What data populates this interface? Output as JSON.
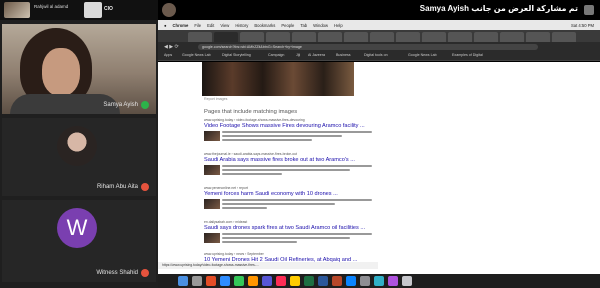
{
  "meeting": {
    "topbar": {
      "self_name": "Rahjwil al adamd",
      "attendees_count": "90 آخرين",
      "logo": "CIO"
    },
    "participants": [
      {
        "name": "Samya Ayish",
        "mic": "on"
      },
      {
        "name": "Riham Abu Aita",
        "mic": "muted"
      },
      {
        "name": "Witness Shahid",
        "initial": "W",
        "mic": "muted"
      }
    ]
  },
  "screen_share": {
    "banner": "تم مشاركة العرض من جانب Samya Ayish"
  },
  "mac_menu": {
    "items": [
      "Chrome",
      "File",
      "Edit",
      "View",
      "History",
      "Bookmarks",
      "People",
      "Tab",
      "Window",
      "Help"
    ],
    "clock": "Sat 4:50 PM"
  },
  "browser": {
    "url": "google.com/search?tbs=sbi:AMhZZit&btnG=Search+by+image",
    "bookmarks": [
      "Apps",
      "Google News Lab",
      "Digital Storytelling",
      "Campaign",
      "Jiji",
      "Al Jazeera",
      "Business",
      "Digital tools on",
      "Google News Lab",
      "Examples of Digital"
    ],
    "status_url": "https://www.uprising.today/video-footage-shows-massive-fires-..."
  },
  "results": {
    "report_link": "Report images",
    "section_heading": "Pages that include matching images",
    "items": [
      {
        "url": "www.uprising.today › video-footage-shows-massive-fires-devouring",
        "title": "Video Footage Shows massive Fires devouring Aramco facility ..."
      },
      {
        "url": "www.thejournal.ie › saudi-arabia-says-massive-fires-broke-out",
        "title": "Saudi Arabia says massive fires broke out at two Aramco's ..."
      },
      {
        "url": "www.yenenonline.net › report",
        "title": "Yemeni forces harm Saudi economy with 10 drones ..."
      },
      {
        "url": "en.dailysabah.com › mideast",
        "title": "Saudi says drones spark fires at two Saudi Aramco oil facilities ..."
      },
      {
        "url": "www.uprising.today › news › September",
        "title": "10 Yemeni Drones Hit 2 Saudi Oil Refineries, at Abqaiq and ..."
      }
    ]
  }
}
